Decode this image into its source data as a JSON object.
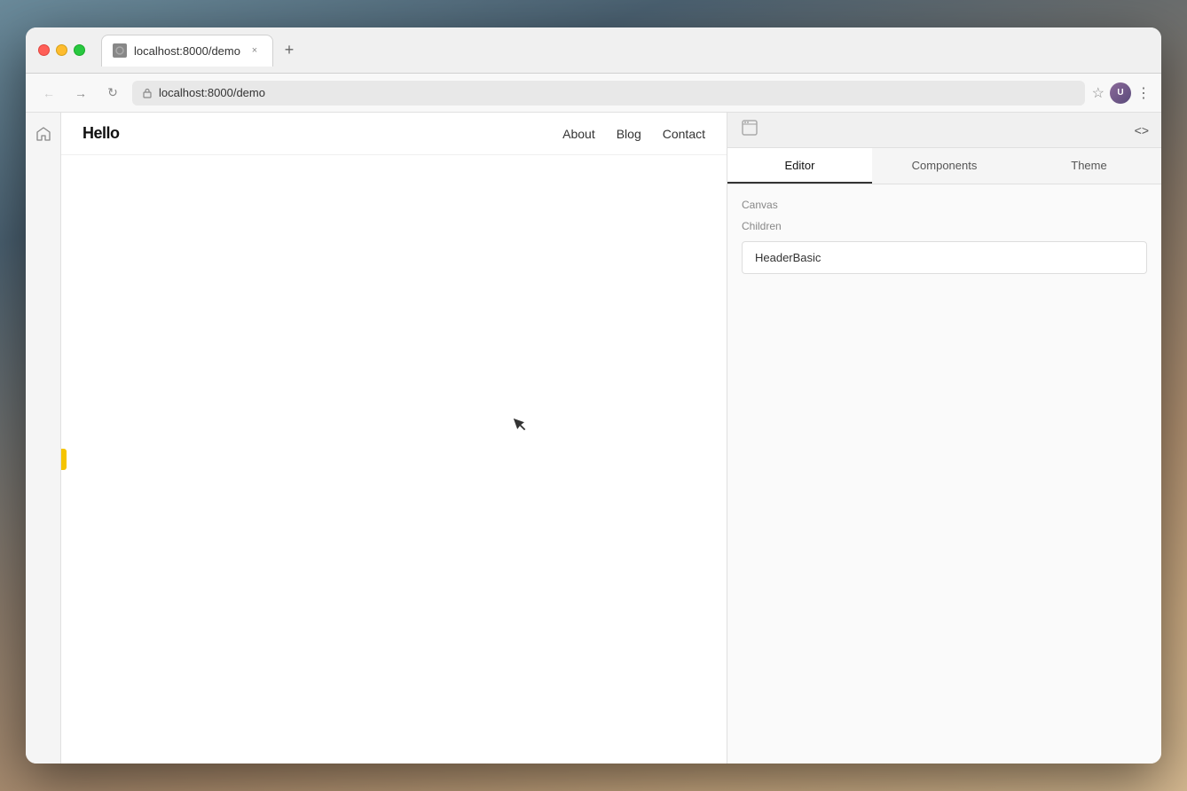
{
  "browser": {
    "url": "localhost:8000/demo",
    "tab_label": "localhost:8000/demo",
    "favicon_alt": "page icon"
  },
  "nav": {
    "back_label": "←",
    "forward_label": "→",
    "refresh_label": "↻",
    "address": "localhost:8000/demo",
    "star_label": "☆",
    "menu_label": "⋮"
  },
  "traffic_lights": {
    "close": "×",
    "minimize": "−",
    "maximize": "+"
  },
  "page_toolbar": {
    "builder_icon": "⬡",
    "code_icon": "<>"
  },
  "site": {
    "logo": "Hello",
    "nav_items": [
      "About",
      "Blog",
      "Contact"
    ]
  },
  "panel": {
    "tabs": [
      "Editor",
      "Components",
      "Theme"
    ],
    "active_tab": "Editor",
    "section_canvas": "Canvas",
    "section_children": "Children",
    "children_item": "HeaderBasic",
    "code_icon": "<>"
  }
}
